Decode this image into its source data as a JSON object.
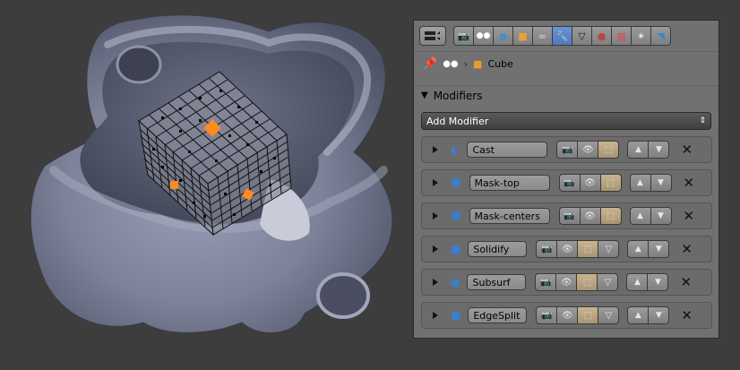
{
  "breadcrumb": {
    "object_name": "Cube"
  },
  "modifiers_panel": {
    "title": "Modifiers",
    "add_modifier_label": "Add Modifier"
  },
  "modifiers": [
    {
      "name": "Cast",
      "icon": "cast-modifier-icon"
    },
    {
      "name": "Mask-top",
      "icon": "mask-modifier-icon"
    },
    {
      "name": "Mask-centers",
      "icon": "mask-modifier-icon"
    },
    {
      "name": "Solidify",
      "icon": "solidify-modifier-icon"
    },
    {
      "name": "Subsurf",
      "icon": "subsurf-modifier-icon"
    },
    {
      "name": "EdgeSplit",
      "icon": "edgesplit-modifier-icon"
    }
  ],
  "property_tabs": [
    "render",
    "scene",
    "world",
    "object",
    "constraints",
    "modifiers",
    "data",
    "material",
    "texture",
    "particles",
    "physics"
  ],
  "colors": {
    "panel_bg": "#717171",
    "viewport_bg": "#3d3d3d",
    "active_tab": "#5b84cc",
    "selection_orange": "#ff8a1f"
  }
}
